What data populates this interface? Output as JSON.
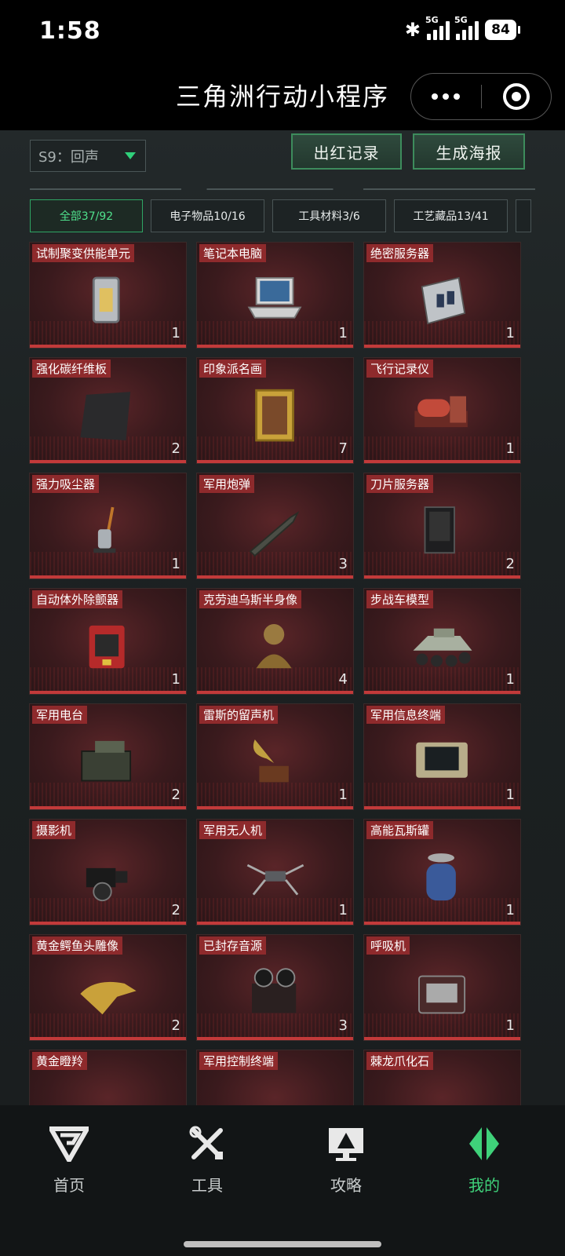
{
  "status_bar": {
    "time": "1:58",
    "battery": "84",
    "network1": "5G",
    "network2": "5G"
  },
  "header": {
    "title": "三角洲行动小程序"
  },
  "toolbar": {
    "season": "S9：回声",
    "red_record": "出红记录",
    "poster": "生成海报"
  },
  "tabs": [
    {
      "label": "全部37/92",
      "active": true
    },
    {
      "label": "电子物品10/16",
      "active": false
    },
    {
      "label": "工具材料3/6",
      "active": false
    },
    {
      "label": "工艺藏品13/41",
      "active": false
    }
  ],
  "items": [
    {
      "name": "试制聚变供能单元",
      "count": "1",
      "icon": "fusion-cell-icon"
    },
    {
      "name": "笔记本电脑",
      "count": "1",
      "icon": "laptop-icon"
    },
    {
      "name": "绝密服务器",
      "count": "1",
      "icon": "server-icon"
    },
    {
      "name": "强化碳纤维板",
      "count": "2",
      "icon": "carbon-plate-icon"
    },
    {
      "name": "印象派名画",
      "count": "7",
      "icon": "painting-icon"
    },
    {
      "name": "飞行记录仪",
      "count": "1",
      "icon": "flight-recorder-icon"
    },
    {
      "name": "强力吸尘器",
      "count": "1",
      "icon": "vacuum-icon"
    },
    {
      "name": "军用炮弹",
      "count": "3",
      "icon": "shell-icon"
    },
    {
      "name": "刀片服务器",
      "count": "2",
      "icon": "blade-server-icon"
    },
    {
      "name": "自动体外除颤器",
      "count": "1",
      "icon": "defibrillator-icon"
    },
    {
      "name": "克劳迪乌斯半身像",
      "count": "4",
      "icon": "bust-icon"
    },
    {
      "name": "步战车模型",
      "count": "1",
      "icon": "ifv-model-icon"
    },
    {
      "name": "军用电台",
      "count": "2",
      "icon": "radio-icon"
    },
    {
      "name": "雷斯的留声机",
      "count": "1",
      "icon": "gramophone-icon"
    },
    {
      "name": "军用信息终端",
      "count": "1",
      "icon": "terminal-icon"
    },
    {
      "name": "摄影机",
      "count": "2",
      "icon": "camera-icon"
    },
    {
      "name": "军用无人机",
      "count": "1",
      "icon": "drone-icon"
    },
    {
      "name": "高能瓦斯罐",
      "count": "1",
      "icon": "gas-tank-icon"
    },
    {
      "name": "黄金鳄鱼头雕像",
      "count": "2",
      "icon": "croc-statue-icon"
    },
    {
      "name": "已封存音源",
      "count": "3",
      "icon": "tape-recorder-icon"
    },
    {
      "name": "呼吸机",
      "count": "1",
      "icon": "ventilator-icon"
    },
    {
      "name": "黄金瞪羚",
      "count": "",
      "icon": "gazelle-icon"
    },
    {
      "name": "军用控制终端",
      "count": "",
      "icon": "control-terminal-icon"
    },
    {
      "name": "棘龙爪化石",
      "count": "",
      "icon": "fossil-icon"
    }
  ],
  "nav": [
    {
      "label": "首页",
      "icon": "home-logo-icon",
      "active": false
    },
    {
      "label": "工具",
      "icon": "tools-icon",
      "active": false
    },
    {
      "label": "攻略",
      "icon": "guide-icon",
      "active": false
    },
    {
      "label": "我的",
      "icon": "profile-icon",
      "active": true
    }
  ],
  "colors": {
    "accent": "#3fd27a",
    "item_tag": "#8e2a2c"
  }
}
